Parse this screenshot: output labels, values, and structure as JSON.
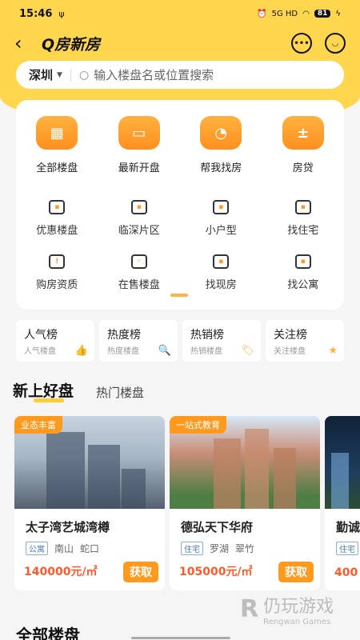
{
  "status_bar": {
    "time": "15:46",
    "usb": "ψ",
    "network": "5G HD",
    "battery": "81"
  },
  "header": {
    "back": "‹",
    "title": "Q房新房",
    "msg_icon": "chat-icon",
    "profile_icon": "user-icon"
  },
  "search": {
    "city": "深圳",
    "placeholder": "输入楼盘名或位置搜索"
  },
  "main_grid": [
    {
      "label": "全部楼盘",
      "icon": "grid-icon",
      "glyph": "▦"
    },
    {
      "label": "最新开盘",
      "icon": "calendar-icon",
      "glyph": "▭"
    },
    {
      "label": "帮我找房",
      "icon": "chat-icon",
      "glyph": "◔"
    },
    {
      "label": "房贷",
      "icon": "calculator-icon",
      "glyph": "±"
    }
  ],
  "sub_grid": [
    {
      "label": "优惠楼盘",
      "icon": "coupon-icon"
    },
    {
      "label": "临深片区",
      "icon": "building-icon"
    },
    {
      "label": "小户型",
      "icon": "floorplan-icon"
    },
    {
      "label": "找住宅",
      "icon": "house-icon"
    },
    {
      "label": "购房资质",
      "icon": "badge-icon"
    },
    {
      "label": "在售楼盘",
      "icon": "tag-icon"
    },
    {
      "label": "找现房",
      "icon": "door-icon"
    },
    {
      "label": "找公寓",
      "icon": "apartment-icon"
    }
  ],
  "rankings": [
    {
      "title": "人气榜",
      "sub": "人气楼盘",
      "icon": "thumb-icon",
      "glyph": "👍"
    },
    {
      "title": "热度榜",
      "sub": "热度楼盘",
      "icon": "search-icon",
      "glyph": "🔍"
    },
    {
      "title": "热销榜",
      "sub": "热销楼盘",
      "icon": "tag-icon",
      "glyph": "🏷"
    },
    {
      "title": "关注榜",
      "sub": "关注楼盘",
      "icon": "star-icon",
      "glyph": "★"
    }
  ],
  "tabs": {
    "active": "新上好盘",
    "other": "热门楼盘"
  },
  "properties": [
    {
      "tag": "业态丰富",
      "name": "太子湾艺城湾樽",
      "type": "公寓",
      "district": "南山",
      "area": "蛇口",
      "price": "140000元/㎡",
      "cta": "获取"
    },
    {
      "tag": "一站式教育",
      "name": "德弘天下华府",
      "type": "住宅",
      "district": "罗湖",
      "area": "翠竹",
      "price": "105000元/㎡",
      "cta": "获取"
    },
    {
      "tag": "",
      "name": "勤诚",
      "type": "住宅",
      "district": "",
      "area": "",
      "price": "400",
      "cta": ""
    }
  ],
  "all_section": {
    "title": "全部楼盘"
  },
  "watermark": {
    "logo": "R",
    "cn": "仍玩游戏",
    "en": "Rengwan Games"
  }
}
